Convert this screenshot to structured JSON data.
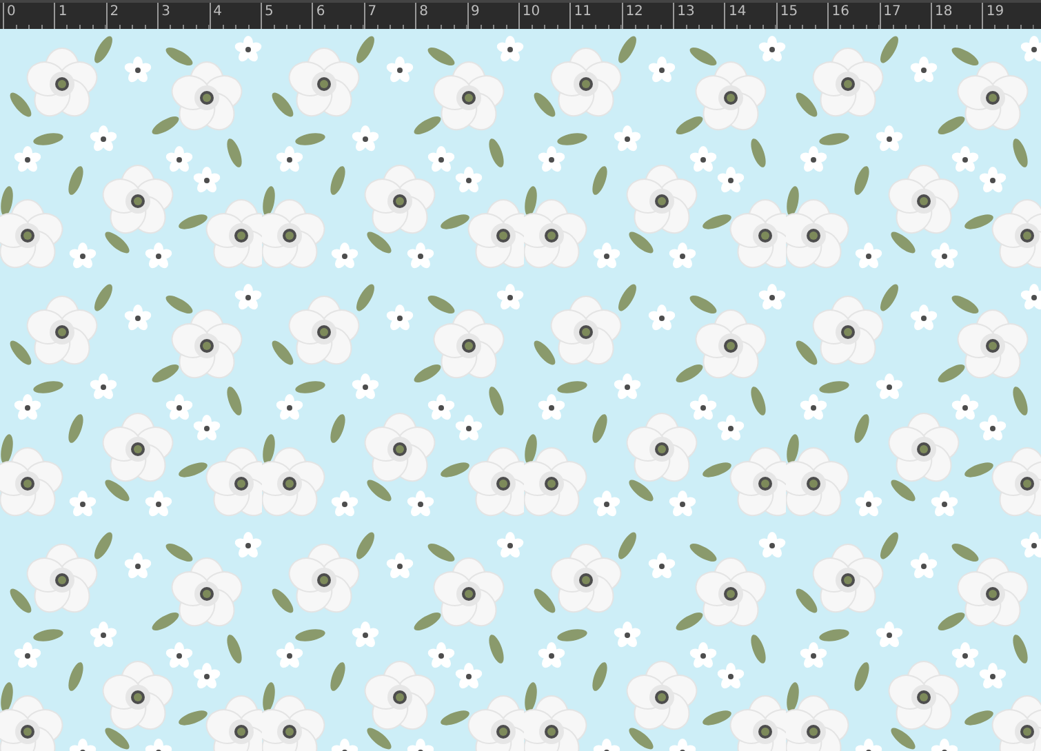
{
  "ruler": {
    "labels": [
      "0",
      "1",
      "2",
      "3",
      "4",
      "5",
      "6",
      "7",
      "8",
      "9",
      "10",
      "11",
      "12",
      "13",
      "14",
      "15",
      "16",
      "17",
      "18",
      "19"
    ]
  }
}
